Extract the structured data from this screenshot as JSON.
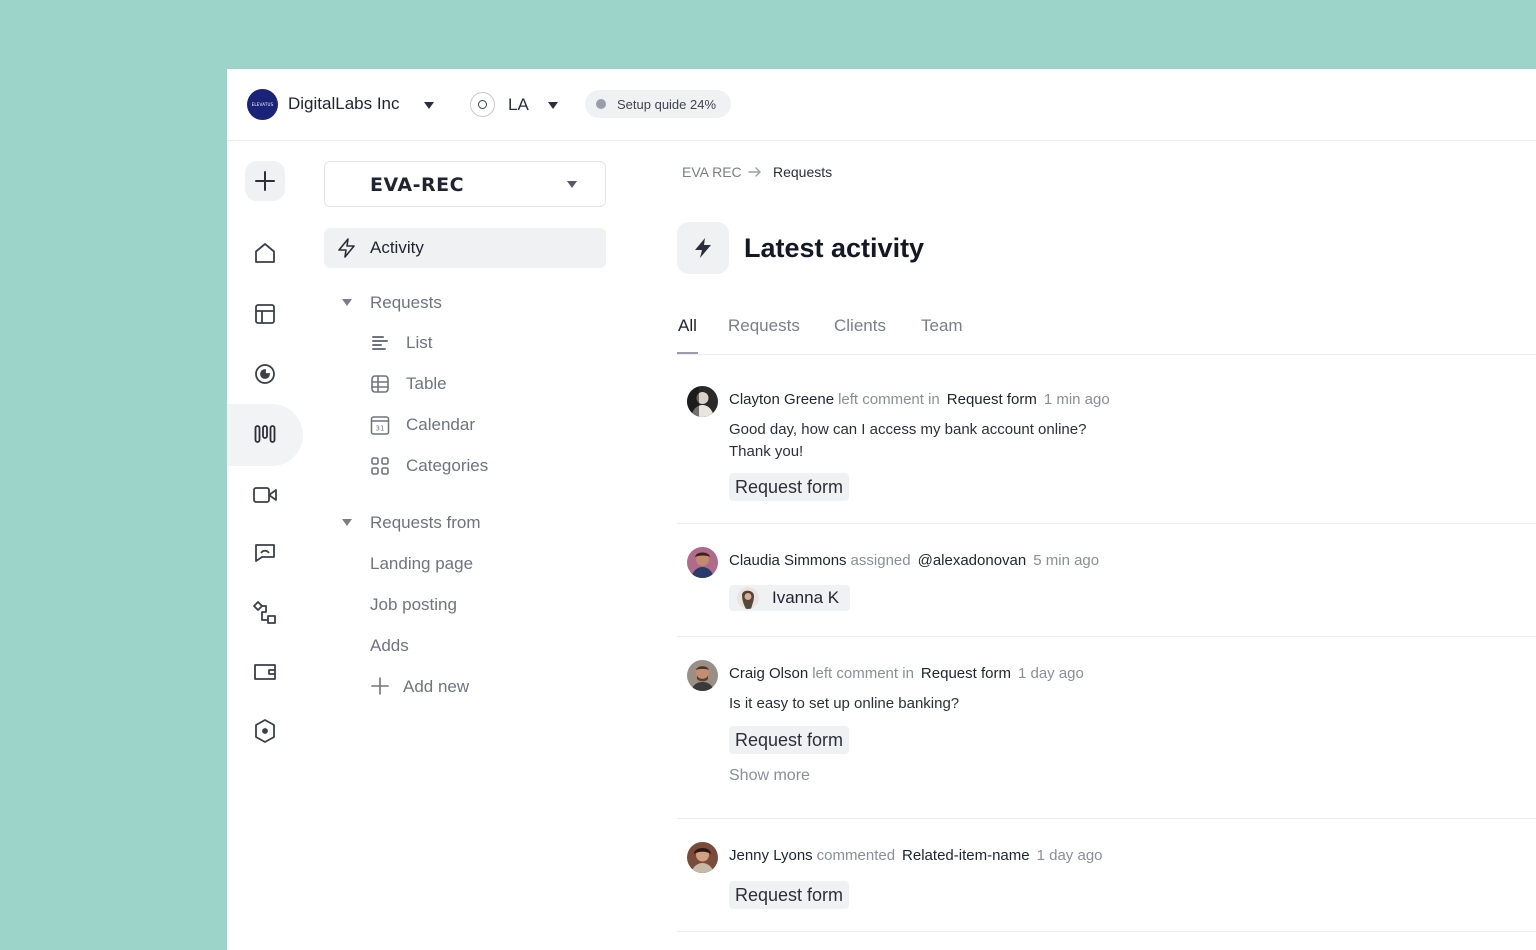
{
  "header": {
    "org_logo_text": "ELEVATUS",
    "org_name": "DigitalLabs Inc",
    "location": "LA",
    "setup_guide": "Setup quide 24%"
  },
  "rail": {
    "icons": [
      "plus-icon",
      "home-icon",
      "layout-icon",
      "analytics-icon",
      "pipeline-icon",
      "video-icon",
      "chat-icon",
      "workflow-icon",
      "wallet-icon",
      "settings-hex-icon"
    ],
    "active": "pipeline-icon"
  },
  "sidebar": {
    "workspace": "EVA-REC",
    "activity_label": "Activity",
    "requests_group": "Requests",
    "requests_items": [
      {
        "label": "List",
        "icon": "list-icon"
      },
      {
        "label": "Table",
        "icon": "table-icon"
      },
      {
        "label": "Calendar",
        "icon": "calendar-icon"
      },
      {
        "label": "Categories",
        "icon": "categories-icon"
      }
    ],
    "calendar_day": "31",
    "from_group": "Requests from",
    "from_items": [
      "Landing page",
      "Job posting",
      "Adds"
    ],
    "add_new": "Add new"
  },
  "breadcrumb": {
    "root": "EVA REC",
    "current": "Requests"
  },
  "main": {
    "title": "Latest activity",
    "tabs": [
      "All",
      "Requests",
      "Clients",
      "Team"
    ],
    "active_tab": "All"
  },
  "feed": [
    {
      "name": "Clayton Greene",
      "verb": "left comment in",
      "target": "Request form",
      "time": "1 min ago",
      "comment_line1": "Good day, how can I access my bank account online?",
      "comment_line2": "Thank you!",
      "chip": "Request form"
    },
    {
      "name": "Claudia Simmons",
      "verb": "assigned",
      "target": "@alexadonovan",
      "time": "5 min ago",
      "assignee": "Ivanna K"
    },
    {
      "name": "Craig Olson",
      "verb": "left comment in",
      "target": "Request form",
      "time": "1 day ago",
      "comment_line1": "Is it easy to set up online banking?",
      "chip": "Request form",
      "show_more": "Show more"
    },
    {
      "name": "Jenny Lyons",
      "verb": "commented",
      "target": "Related-item-name",
      "time": "1 day ago",
      "chip": "Request form"
    }
  ],
  "colors": {
    "backdrop": "#9cd4c9",
    "brand_logo": "#1a2378",
    "surface_muted": "#f0f1f3",
    "text_primary": "#1f2430",
    "text_secondary": "#6f7380"
  }
}
